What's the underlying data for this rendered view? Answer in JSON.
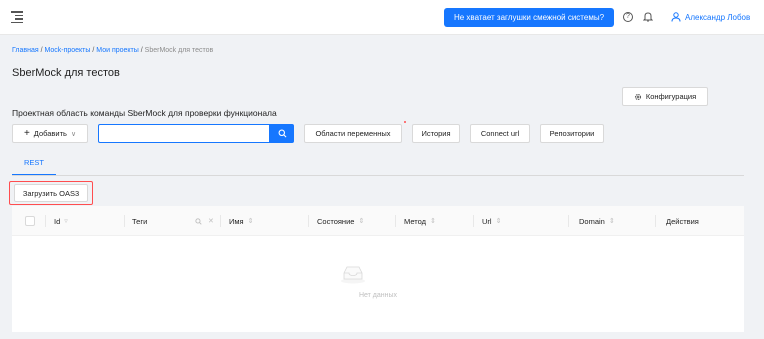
{
  "topbar": {
    "menu_icon": "menu-fold-icon",
    "cta_label": "Не хватает заглушки смежной системы?",
    "help_icon": "question-circle-icon",
    "bell_icon": "bell-icon",
    "user_icon": "user-icon",
    "user_name": "Александр Лобов"
  },
  "breadcrumb": {
    "items": [
      "Главная",
      "Mock-проекты",
      "Мои проекты"
    ],
    "current": "SberMock для тестов",
    "separator": "/"
  },
  "page": {
    "title": "SberMock для тестов",
    "config_label": "Конфигурация",
    "section_title": "Проектная область команды SberMock для проверки функционала"
  },
  "toolbar": {
    "add_label": "Добавить",
    "search_value": "",
    "search_placeholder": "",
    "variables_label": "Области переменных",
    "history_label": "История",
    "connect_label": "Connect url",
    "repo_label": "Репозитории"
  },
  "tabs": [
    {
      "label": "REST",
      "active": true
    }
  ],
  "upload": {
    "label": "Загрузить OAS3"
  },
  "table": {
    "columns": [
      "Id",
      "Теги",
      "Имя",
      "Состояние",
      "Метод",
      "Url",
      "Domain",
      "Действия"
    ],
    "empty_text": "Нет данных"
  },
  "colors": {
    "accent": "#1677ff",
    "highlight": "#ff4d4f"
  }
}
